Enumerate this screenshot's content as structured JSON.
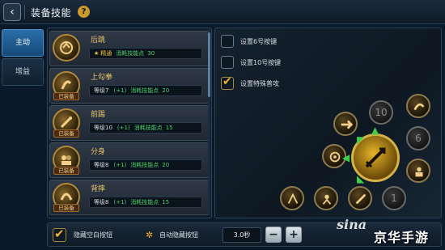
{
  "header": {
    "back_icon": "back-arrow-icon",
    "title": "装备技能",
    "help_label": "?"
  },
  "tabs": [
    {
      "label": "主动",
      "active": true
    },
    {
      "label": "增益",
      "active": false
    }
  ],
  "skills": [
    {
      "name": "后跳",
      "equipped": false,
      "mastery_star": "★",
      "mastery_label": "精通",
      "cost_label": "消耗技能点",
      "cost": "30",
      "icon": "backflip-icon"
    },
    {
      "name": "上勾拳",
      "equipped": true,
      "equipped_label": "已装备",
      "level": "等级7",
      "bonus": "(+1)",
      "cost_label": "消耗技能点",
      "cost": "20",
      "icon": "uppercut-icon"
    },
    {
      "name": "前踢",
      "equipped": true,
      "equipped_label": "已装备",
      "level": "等级10",
      "bonus": "(+1)",
      "cost_label": "消耗技能点",
      "cost": "15",
      "icon": "front-kick-icon"
    },
    {
      "name": "分身",
      "equipped": true,
      "equipped_label": "已装备",
      "level": "等级8",
      "bonus": "(+1)",
      "cost_label": "消耗技能点",
      "cost": "20",
      "icon": "clone-icon"
    },
    {
      "name": "背摔",
      "equipped": true,
      "equipped_label": "已装备",
      "level": "等级8",
      "bonus": "(+1)",
      "cost_label": "消耗技能点",
      "cost": "15",
      "icon": "back-throw-icon"
    }
  ],
  "settings": {
    "options": [
      {
        "label": "设置6号按键",
        "checked": false
      },
      {
        "label": "设置10号按键",
        "checked": false
      },
      {
        "label": "设置特殊普攻",
        "checked": true
      }
    ],
    "slots": [
      {
        "label": "10",
        "empty": true
      },
      {
        "label": "6",
        "empty": true
      },
      {
        "label": "1",
        "empty": true
      }
    ]
  },
  "bottom": {
    "hide_blank_label": "隐藏空白按钮",
    "auto_hide_label": "自动隐藏按钮",
    "time_value": "3.0秒",
    "minus_label": "−",
    "plus_label": "+"
  },
  "watermark": {
    "sina": "sina",
    "site": "京华手游"
  },
  "colors": {
    "accent_gold": "#f2b32a",
    "tab_active": "#2a6ea8",
    "green_text": "#4fd06a",
    "skill_name": "#e8c36a"
  }
}
